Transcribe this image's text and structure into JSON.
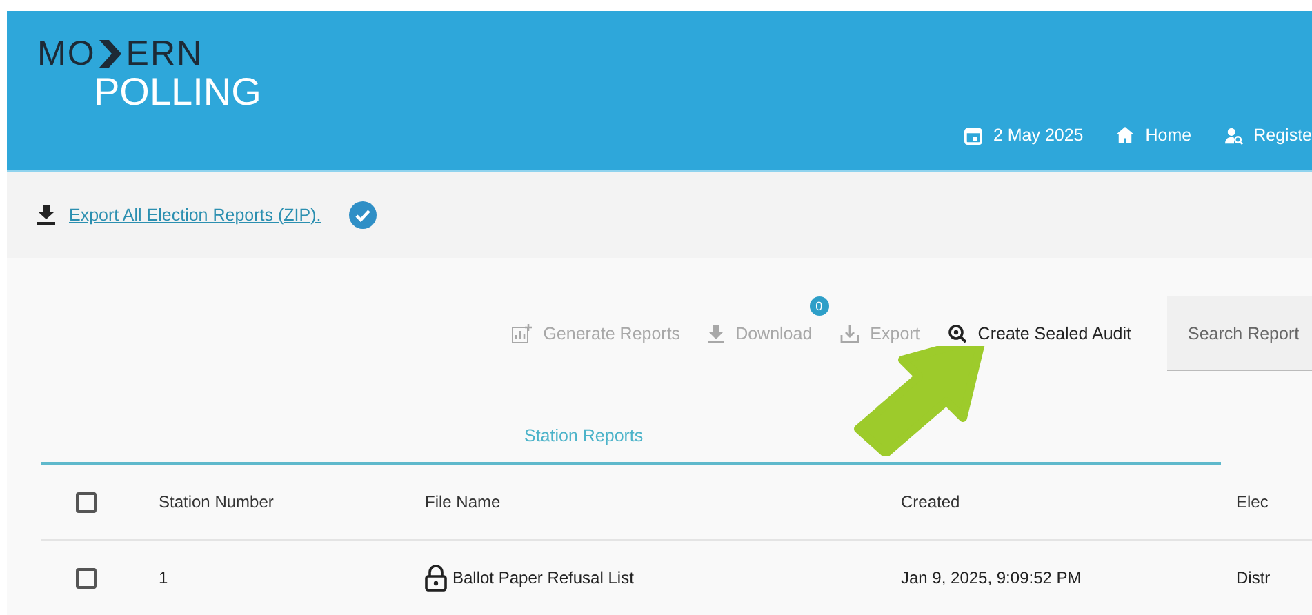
{
  "logo": {
    "top_left": "MO",
    "top_right": "ERN",
    "bottom": "POLLING"
  },
  "nav": [
    {
      "kind": "calendar",
      "label": "2 May 2025"
    },
    {
      "kind": "home",
      "label": "Home"
    },
    {
      "kind": "register",
      "label": "Registe"
    }
  ],
  "export_bar": {
    "link": "Export All Election Reports (ZIP).",
    "done": true
  },
  "toolbar": [
    {
      "kind": "generate",
      "label": "Generate Reports",
      "disabled": true
    },
    {
      "kind": "download",
      "label": "Download",
      "disabled": true,
      "badge": "0"
    },
    {
      "kind": "export",
      "label": "Export",
      "disabled": true
    },
    {
      "kind": "audit",
      "label": "Create Sealed Audit",
      "disabled": false
    }
  ],
  "search": {
    "placeholder": "Search Report"
  },
  "tabs": [
    {
      "label": "Station Reports",
      "selected": true
    }
  ],
  "table": {
    "select_all_checked": false,
    "columns": [
      "Station Number",
      "File Name",
      "Created",
      "Elec"
    ],
    "rows": [
      {
        "checked": false,
        "locked": true,
        "cells": [
          "1",
          "Ballot Paper Refusal List",
          "Jan 9, 2025, 9:09:52 PM",
          "Distr"
        ]
      }
    ]
  }
}
